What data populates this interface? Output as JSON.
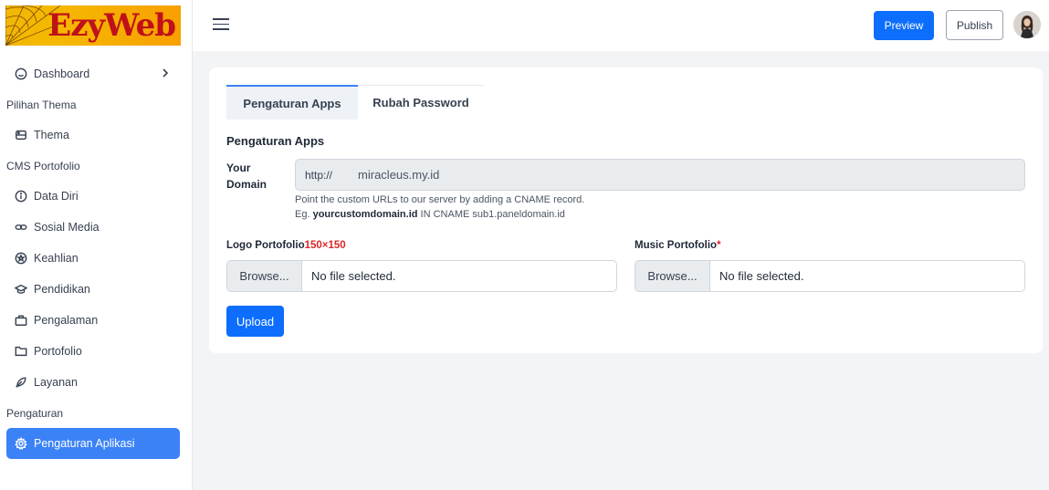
{
  "brand": {
    "name": "EzyWeb"
  },
  "sidebar": {
    "dashboard": "Dashboard",
    "section_theme": "Pilihan Thema",
    "thema": "Thema",
    "section_cms": "CMS Portofolio",
    "data_diri": "Data Diri",
    "sosial_media": "Sosial Media",
    "keahlian": "Keahlian",
    "pendidikan": "Pendidikan",
    "pengalaman": "Pengalaman",
    "portofolio": "Portofolio",
    "layanan": "Layanan",
    "section_settings": "Pengaturan",
    "pengaturan_aplikasi": "Pengaturan Aplikasi"
  },
  "header": {
    "preview_label": "Preview",
    "publish_label": "Publish"
  },
  "tabs": [
    {
      "label": "Pengaturan Apps",
      "active": true
    },
    {
      "label": "Rubah Password",
      "active": false
    }
  ],
  "form": {
    "title": "Pengaturan Apps",
    "domain_label": "Your Domain",
    "domain_prefix": "http://",
    "domain_value": "miracleus.my.id",
    "help_line1": "Point the custom URLs to our server by adding a CNAME record.",
    "help_prefix": "Eg.",
    "help_example": "yourcustomdomain.id",
    "help_suffix": "IN CNAME sub1.paneldomain.id",
    "logo_label": "Logo Portofolio",
    "logo_hint": "150×150",
    "music_label": "Music Portofolio",
    "required_mark": "*",
    "browse_label": "Browse...",
    "no_file": "No file selected.",
    "upload_label": "Upload"
  },
  "colors": {
    "primary": "#0d6efd",
    "active_nav": "#3b82f6",
    "required": "#dc2626",
    "logo_text": "#c0101a",
    "logo_bg": "#f5b800"
  }
}
